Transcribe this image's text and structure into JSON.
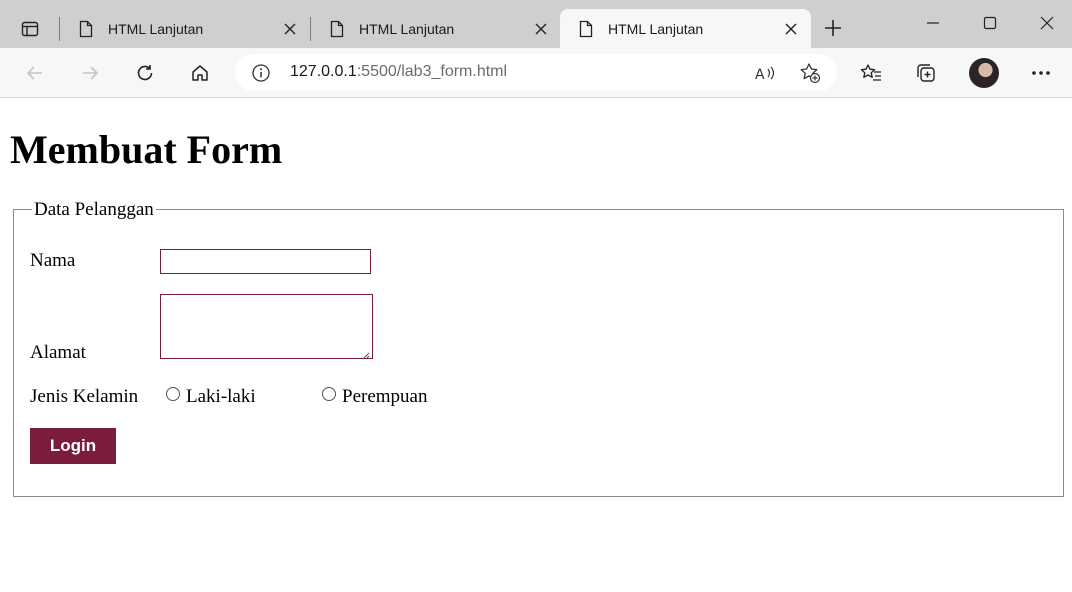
{
  "browser": {
    "tabs": [
      {
        "title": "HTML Lanjutan",
        "active": false
      },
      {
        "title": "HTML Lanjutan",
        "active": false
      },
      {
        "title": "HTML Lanjutan",
        "active": true
      }
    ],
    "address": {
      "host": "127.0.0.1",
      "path": ":5500/lab3_form.html"
    },
    "icons": [
      "tab-actions-icon",
      "file-icon",
      "close-icon",
      "new-tab-icon",
      "minimize-icon",
      "maximize-icon",
      "window-close-icon",
      "back-icon",
      "forward-icon",
      "refresh-icon",
      "home-icon",
      "info-icon",
      "read-aloud-icon",
      "add-favorite-icon",
      "favorites-icon",
      "collections-icon",
      "profile-avatar",
      "more-icon"
    ]
  },
  "page": {
    "title": "Membuat Form",
    "form": {
      "legend": "Data Pelanggan",
      "nama_label": "Nama",
      "nama_value": "",
      "alamat_label": "Alamat",
      "alamat_value": "",
      "gender_label": "Jenis Kelamin",
      "gender_options": [
        "Laki-laki",
        "Perempuan"
      ],
      "submit_label": "Login"
    }
  },
  "colors": {
    "accent": "#7b1c3c",
    "tabstrip": "#cfcfcf",
    "toolbar": "#f7f7f7"
  }
}
